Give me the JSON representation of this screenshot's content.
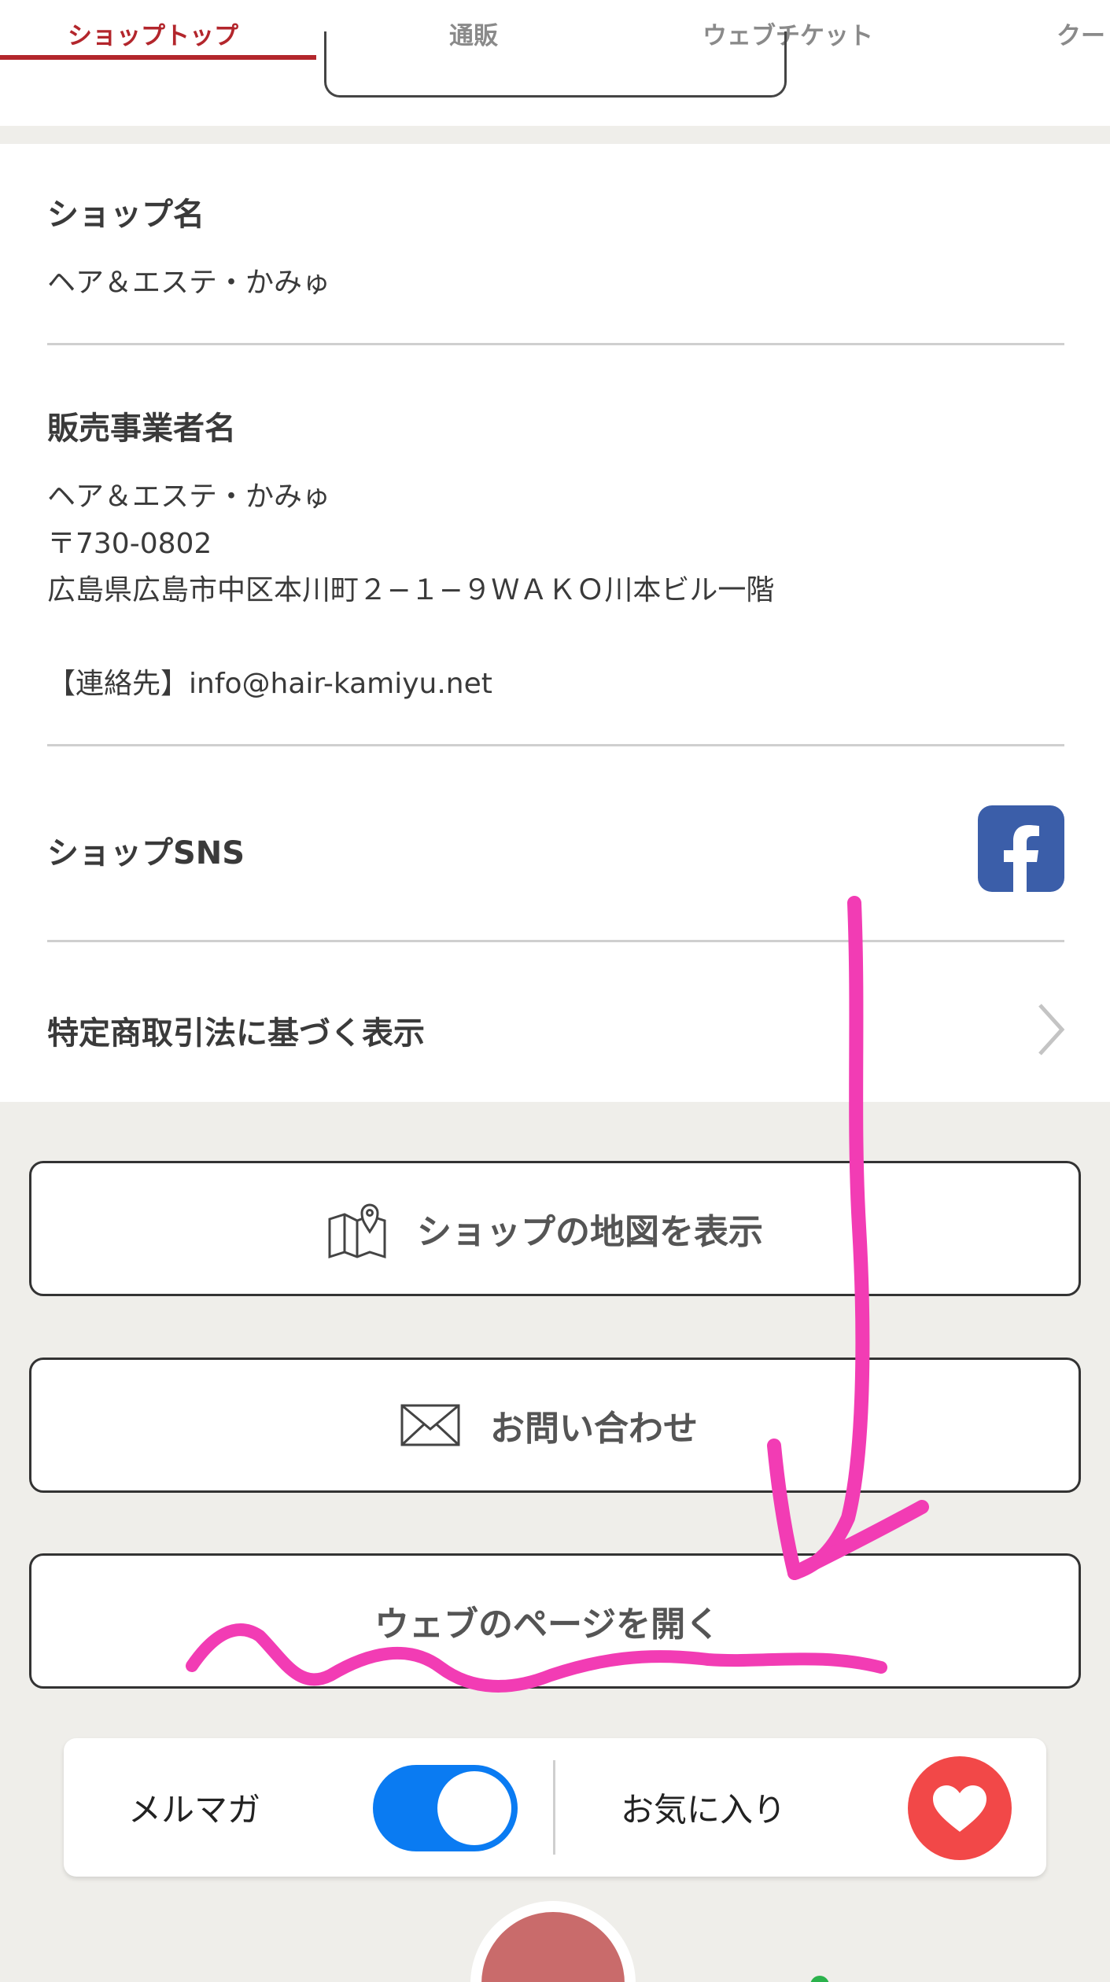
{
  "tabs": {
    "shop_top": "ショップトップ",
    "mail_order": "通販",
    "web_ticket": "ウェブチケット",
    "coupon": "クー"
  },
  "shop_name": {
    "heading": "ショップ名",
    "value": "ヘア＆エステ・かみゅ"
  },
  "seller": {
    "heading": "販売事業者名",
    "name": "ヘア＆エステ・かみゅ",
    "postal": "〒730-0802",
    "address": "広島県広島市中区本川町２−１−９ＷＡＫＯ川本ビル一階",
    "contact": "【連絡先】info@hair-kamiyu.net"
  },
  "sns": {
    "heading": "ショップSNS",
    "icon": "facebook-icon"
  },
  "legal": {
    "label": "特定商取引法に基づく表示"
  },
  "buttons": {
    "map": "ショップの地図を表示",
    "contact": "お問い合わせ",
    "web": "ウェブのページを開く"
  },
  "bottom_bar": {
    "newsletter_label": "メルマガ",
    "newsletter_on": true,
    "favorite_label": "お気に入り"
  },
  "colors": {
    "accent": "#b3262c",
    "toggle": "#0a7bf2",
    "heart": "#f24848",
    "facebook": "#3b5ea9",
    "annotation": "#f23cb4"
  }
}
